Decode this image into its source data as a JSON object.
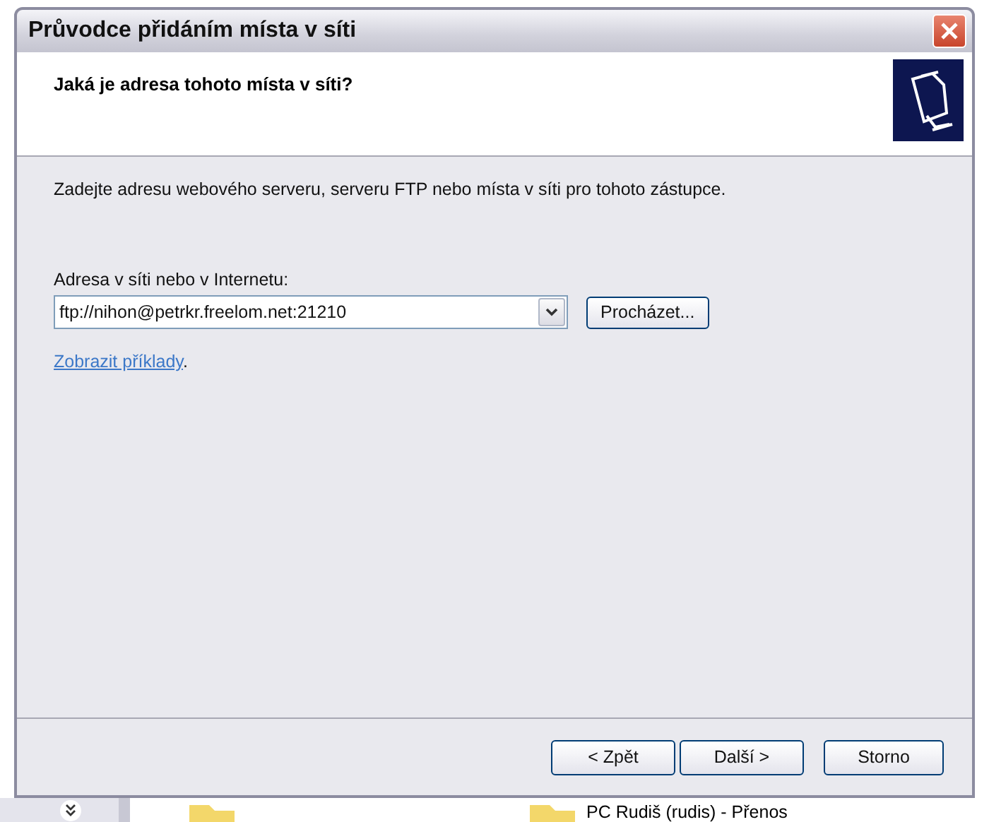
{
  "window": {
    "title": "Průvodce přidáním místa v síti"
  },
  "header": {
    "heading": "Jaká je adresa tohoto místa v síti?"
  },
  "body": {
    "instruction": "Zadejte adresu webového serveru, serveru FTP nebo místa v síti pro tohoto zástupce.",
    "address_label": "Adresa v síti nebo v Internetu:",
    "address_value": "ftp://nihon@petrkr.freelom.net:21210",
    "browse_button": "Procházet...",
    "examples_link": "Zobrazit příklady",
    "examples_link_tail": "."
  },
  "buttons": [
    {
      "label": "< Zpět",
      "kind": "nav"
    },
    {
      "label": "Další >",
      "kind": "nav"
    },
    {
      "label": "Storno",
      "kind": "cancel"
    }
  ],
  "background": {
    "items": [
      {
        "label": "PC Rudiš (rudis) - Přenos"
      }
    ]
  }
}
